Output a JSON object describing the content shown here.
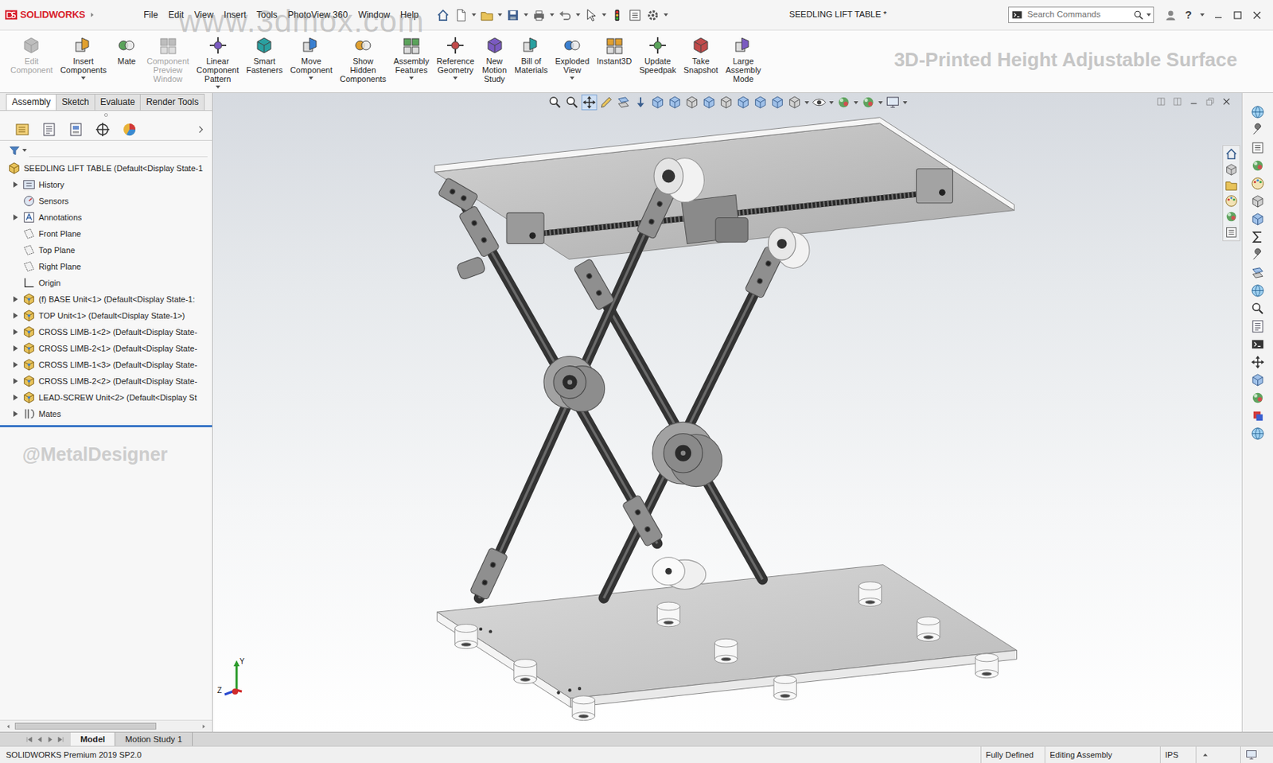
{
  "window": {
    "title": "SEEDLING LIFT TABLE *",
    "logo": "SOLIDWORKS",
    "watermark": "www.3dmox.com",
    "help": "?"
  },
  "menu": [
    "File",
    "Edit",
    "View",
    "Insert",
    "Tools",
    "PhotoView 360",
    "Window",
    "Help"
  ],
  "search": {
    "placeholder": "Search Commands"
  },
  "ribbon": {
    "tools": [
      {
        "label": "Edit Component",
        "disabled": true,
        "dropdown": false
      },
      {
        "label": "Insert Components",
        "disabled": false,
        "dropdown": true
      },
      {
        "label": "Mate",
        "disabled": false,
        "dropdown": false
      },
      {
        "label": "Component Preview Window",
        "disabled": true,
        "dropdown": false
      },
      {
        "label": "Linear Component Pattern",
        "disabled": false,
        "dropdown": true
      },
      {
        "label": "Smart Fasteners",
        "disabled": false,
        "dropdown": false
      },
      {
        "label": "Move Component",
        "disabled": false,
        "dropdown": true
      },
      {
        "label": "Show Hidden Components",
        "disabled": false,
        "dropdown": false
      },
      {
        "label": "Assembly Features",
        "disabled": false,
        "dropdown": true
      },
      {
        "label": "Reference Geometry",
        "disabled": false,
        "dropdown": true
      },
      {
        "label": "New Motion Study",
        "disabled": false,
        "dropdown": false
      },
      {
        "label": "Bill of Materials",
        "disabled": false,
        "dropdown": false
      },
      {
        "label": "Exploded View",
        "disabled": false,
        "dropdown": true
      },
      {
        "label": "Instant3D",
        "disabled": false,
        "dropdown": false
      },
      {
        "label": "Update Speedpak",
        "disabled": false,
        "dropdown": false
      },
      {
        "label": "Take Snapshot",
        "disabled": false,
        "dropdown": false
      },
      {
        "label": "Large Assembly Mode",
        "disabled": false,
        "dropdown": false
      }
    ],
    "banner": "3D-Printed Height Adjustable Surface"
  },
  "command_tabs": [
    {
      "label": "Assembly",
      "selected": true
    },
    {
      "label": "Sketch",
      "selected": false
    },
    {
      "label": "Evaluate",
      "selected": false
    },
    {
      "label": "Render Tools",
      "selected": false
    }
  ],
  "feature_tree": {
    "root": "SEEDLING LIFT TABLE (Default<Display State-1",
    "items": [
      {
        "label": "History",
        "kind": "history",
        "expandable": true
      },
      {
        "label": "Sensors",
        "kind": "sensors",
        "expandable": false
      },
      {
        "label": "Annotations",
        "kind": "annotations",
        "expandable": true
      },
      {
        "label": "Front Plane",
        "kind": "plane",
        "expandable": false
      },
      {
        "label": "Top Plane",
        "kind": "plane",
        "expandable": false
      },
      {
        "label": "Right Plane",
        "kind": "plane",
        "expandable": false
      },
      {
        "label": "Origin",
        "kind": "origin",
        "expandable": false
      },
      {
        "label": "(f) BASE Unit<1> (Default<Display State-1:",
        "kind": "component",
        "expandable": true
      },
      {
        "label": "TOP Unit<1> (Default<Display State-1>)",
        "kind": "component",
        "expandable": true
      },
      {
        "label": "CROSS LIMB-1<2> (Default<Display State-",
        "kind": "component",
        "expandable": true
      },
      {
        "label": "CROSS LIMB-2<1> (Default<Display State-",
        "kind": "component",
        "expandable": true
      },
      {
        "label": "CROSS LIMB-1<3> (Default<Display State-",
        "kind": "component",
        "expandable": true
      },
      {
        "label": "CROSS LIMB-2<2> (Default<Display State-",
        "kind": "component",
        "expandable": true
      },
      {
        "label": "LEAD-SCREW Unit<2> (Default<Display St",
        "kind": "component",
        "expandable": true
      },
      {
        "label": "Mates",
        "kind": "mates",
        "expandable": true
      }
    ]
  },
  "credit": "@MetalDesigner",
  "model_tabs": [
    {
      "label": "Model",
      "selected": true
    },
    {
      "label": "Motion Study 1",
      "selected": false
    }
  ],
  "status_bar": {
    "product": "SOLIDWORKS Premium 2019 SP2.0",
    "state": "Fully Defined",
    "mode": "Editing Assembly",
    "units": "IPS"
  },
  "triad": {
    "y": "Y",
    "z": "Z"
  }
}
